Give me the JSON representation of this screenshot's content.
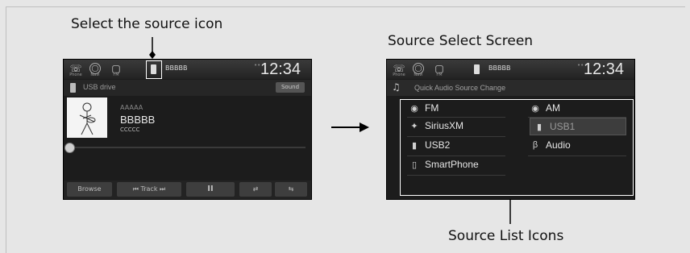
{
  "labels": {
    "left_callout": "Select the source icon",
    "right_title": "Source Select Screen",
    "bottom_callout": "Source List Icons"
  },
  "left_screen": {
    "topbar": {
      "phone": "Phone",
      "navi": "Navi",
      "fm": "FM",
      "source_text": "BBBBB",
      "clock": "12:34"
    },
    "source_name": "USB drive",
    "sound_button": "Sound",
    "track_lines": [
      "AAAAA",
      "BBBBB",
      "CCCCC"
    ],
    "controls": {
      "browse": "Browse",
      "track": "Track",
      "pause": "II",
      "repeat": "⇄",
      "shuffle": "⇆"
    }
  },
  "right_screen": {
    "topbar": {
      "phone": "Phone",
      "navi": "Navi",
      "fm": "FM",
      "source_text": "BBBBB",
      "clock": "12:34"
    },
    "header": "Quick Audio Source Change",
    "sources_left": [
      "FM",
      "SiriusXM",
      "USB2",
      "SmartPhone"
    ],
    "sources_right": [
      "AM",
      "USB1",
      "Audio"
    ]
  },
  "colors": {
    "highlight_box": "#ffffff",
    "screen_bg": "#1c1c1c"
  }
}
